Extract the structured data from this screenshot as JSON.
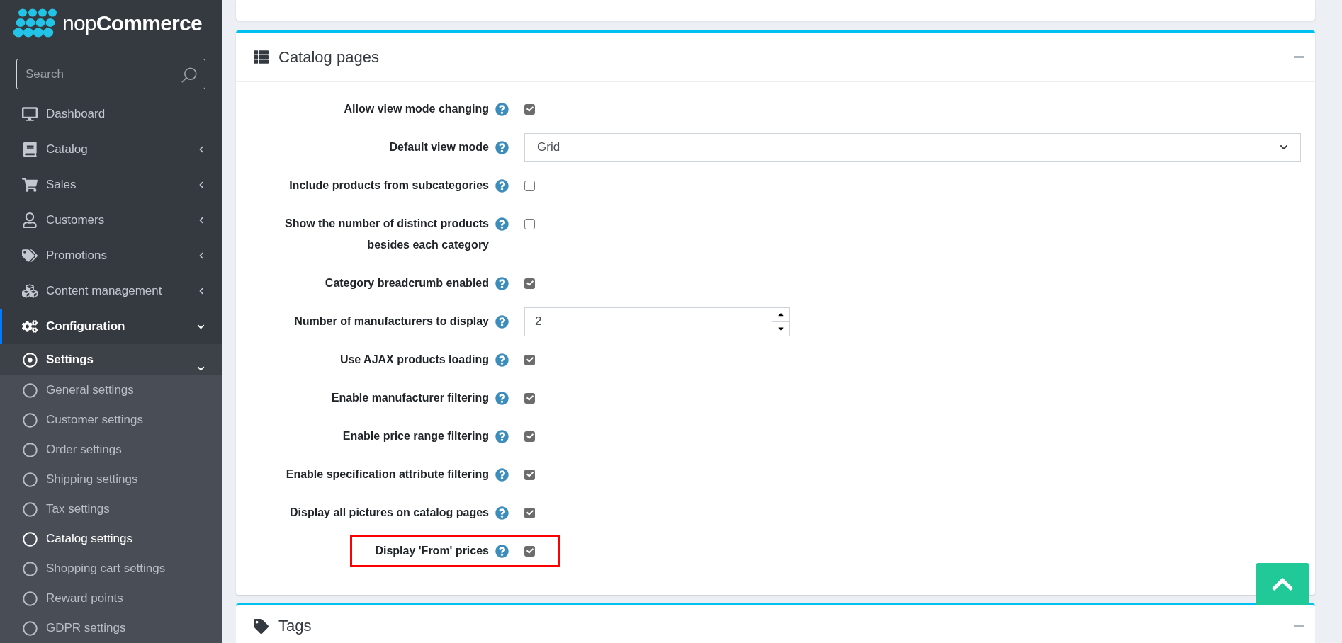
{
  "logo": {
    "light": "nop",
    "bold": "Commerce"
  },
  "sidebar": {
    "search": {
      "placeholder": "Search"
    },
    "items": [
      {
        "label": "Dashboard",
        "collapsible": false,
        "expanded": false,
        "selected": false
      },
      {
        "label": "Catalog",
        "collapsible": true,
        "expanded": false,
        "selected": false
      },
      {
        "label": "Sales",
        "collapsible": true,
        "expanded": false,
        "selected": false
      },
      {
        "label": "Customers",
        "collapsible": true,
        "expanded": false,
        "selected": false
      },
      {
        "label": "Promotions",
        "collapsible": true,
        "expanded": false,
        "selected": false
      },
      {
        "label": "Content management",
        "collapsible": true,
        "expanded": false,
        "selected": false
      },
      {
        "label": "Configuration",
        "collapsible": true,
        "expanded": true,
        "selected": true,
        "children": [
          {
            "label": "Settings",
            "expanded": true,
            "selected": true,
            "children": [
              {
                "label": "General settings",
                "selected": false
              },
              {
                "label": "Customer settings",
                "selected": false
              },
              {
                "label": "Order settings",
                "selected": false
              },
              {
                "label": "Shipping settings",
                "selected": false
              },
              {
                "label": "Tax settings",
                "selected": false
              },
              {
                "label": "Catalog settings",
                "selected": true
              },
              {
                "label": "Shopping cart settings",
                "selected": false
              },
              {
                "label": "Reward points",
                "selected": false
              },
              {
                "label": "GDPR settings",
                "selected": false
              }
            ]
          }
        ]
      }
    ]
  },
  "catalog_card": {
    "title": "Catalog pages",
    "rows": [
      {
        "kind": "checkbox",
        "label": "Allow view mode changing",
        "checked": true,
        "highlighted": false
      },
      {
        "kind": "select",
        "label": "Default view mode",
        "value": "Grid",
        "highlighted": false
      },
      {
        "kind": "checkbox",
        "label": "Include products from subcategories",
        "checked": false,
        "highlighted": false
      },
      {
        "kind": "checkbox",
        "label": "Show the number of distinct products besides each category",
        "checked": false,
        "highlighted": false
      },
      {
        "kind": "checkbox",
        "label": "Category breadcrumb enabled",
        "checked": true,
        "highlighted": false
      },
      {
        "kind": "number",
        "label": "Number of manufacturers to display",
        "value": "2",
        "highlighted": false
      },
      {
        "kind": "checkbox",
        "label": "Use AJAX products loading",
        "checked": true,
        "highlighted": false
      },
      {
        "kind": "checkbox",
        "label": "Enable manufacturer filtering",
        "checked": true,
        "highlighted": false
      },
      {
        "kind": "checkbox",
        "label": "Enable price range filtering",
        "checked": true,
        "highlighted": false
      },
      {
        "kind": "checkbox",
        "label": "Enable specification attribute filtering",
        "checked": true,
        "highlighted": false
      },
      {
        "kind": "checkbox",
        "label": "Display all pictures on catalog pages",
        "checked": true,
        "highlighted": false
      },
      {
        "kind": "checkbox",
        "label": "Display 'From' prices",
        "checked": true,
        "highlighted": true
      }
    ]
  },
  "tags_card": {
    "title": "Tags"
  }
}
